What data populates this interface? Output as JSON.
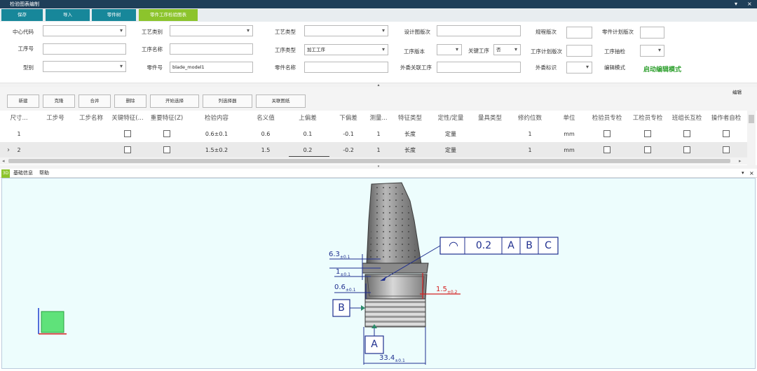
{
  "window": {
    "title": "检验图表编制",
    "minimize": "▾",
    "close": "×"
  },
  "tabs": [
    {
      "label": "保存"
    },
    {
      "label": "导入"
    },
    {
      "label": "零件树"
    },
    {
      "label": "零件工序检验图表"
    }
  ],
  "form": {
    "center_code": {
      "label": "中心代码",
      "value": ""
    },
    "process_category": {
      "label": "工艺类别",
      "value": ""
    },
    "process_type": {
      "label": "工艺类型",
      "value": ""
    },
    "design_version": {
      "label": "设计图版次",
      "value": ""
    },
    "spec_version": {
      "label": "规程版次",
      "value": ""
    },
    "part_plan_version": {
      "label": "零件计划版次",
      "value": ""
    },
    "op_no": {
      "label": "工序号",
      "value": ""
    },
    "op_name": {
      "label": "工序名称",
      "value": ""
    },
    "op_type": {
      "label": "工序类型",
      "value": "加工工序"
    },
    "op_version": {
      "label": "工序版本",
      "value": ""
    },
    "key_op": {
      "label": "关键工序",
      "value": "否"
    },
    "op_plan_version": {
      "label": "工序计划版次",
      "value": ""
    },
    "op_sampling": {
      "label": "工序抽检",
      "value": ""
    },
    "model": {
      "label": "型别",
      "value": ""
    },
    "part_no": {
      "label": "零件号",
      "value": "blade_model1"
    },
    "part_name": {
      "label": "零件名称",
      "value": ""
    },
    "outsource_op": {
      "label": "外委关联工序",
      "value": ""
    },
    "outsource_flag": {
      "label": "外委标识",
      "value": ""
    },
    "edit_mode": {
      "label": "编辑模式",
      "value": "启动编辑模式"
    }
  },
  "toolbar": [
    "新建",
    "克隆",
    "合并",
    "删除",
    "开始选择",
    "列选择器",
    "关联图纸"
  ],
  "edit_label": "编辑",
  "grid": {
    "headers": [
      "尺寸...",
      "工步号",
      "工步名称",
      "关键特征(...",
      "重要特征(Z)",
      "检验内容",
      "名义值",
      "上偏差",
      "下偏差",
      "测量...",
      "特征类型",
      "定性/定量",
      "量具类型",
      "修约位数",
      "单位",
      "检验员专检",
      "工检员专检",
      "班组长互检",
      "操作者自检"
    ],
    "rows": [
      {
        "expander": "",
        "cells": [
          "1",
          "",
          "",
          "",
          "",
          "0.6±0.1",
          "0.6",
          "0.1",
          "-0.1",
          "1",
          "长度",
          "定量",
          "",
          "1",
          "mm"
        ]
      },
      {
        "expander": "›",
        "cells": [
          "2",
          "",
          "",
          "",
          "",
          "1.5±0.2",
          "1.5",
          "0.2",
          "-0.2",
          "1",
          "长度",
          "定量",
          "",
          "1",
          "mm"
        ]
      }
    ]
  },
  "view_tabs": [
    "3D",
    "基础信息",
    "帮助"
  ],
  "drawing": {
    "gdt": {
      "symbol": "◠",
      "tolerance": "0.2",
      "datums": [
        "A",
        "B",
        "C"
      ]
    },
    "dims": [
      {
        "value": "6.3",
        "tol": "±0.1"
      },
      {
        "value": "1",
        "tol": "±0.1"
      },
      {
        "value": "0.6",
        "tol": "±0.1"
      },
      {
        "value": "1.5",
        "tol": "±0.2"
      },
      {
        "value": "33.4",
        "tol": "±0.1"
      }
    ],
    "datum_b": "B",
    "datum_a": "A"
  },
  "colors": {
    "titlebar": "#1f3f59",
    "tab": "#17879a",
    "tab_active": "#8cc42c",
    "viewport": "#edfdfd",
    "dim_blue": "#1f2f8f",
    "dim_red": "#d42020",
    "edit_green": "#2fa02f"
  }
}
